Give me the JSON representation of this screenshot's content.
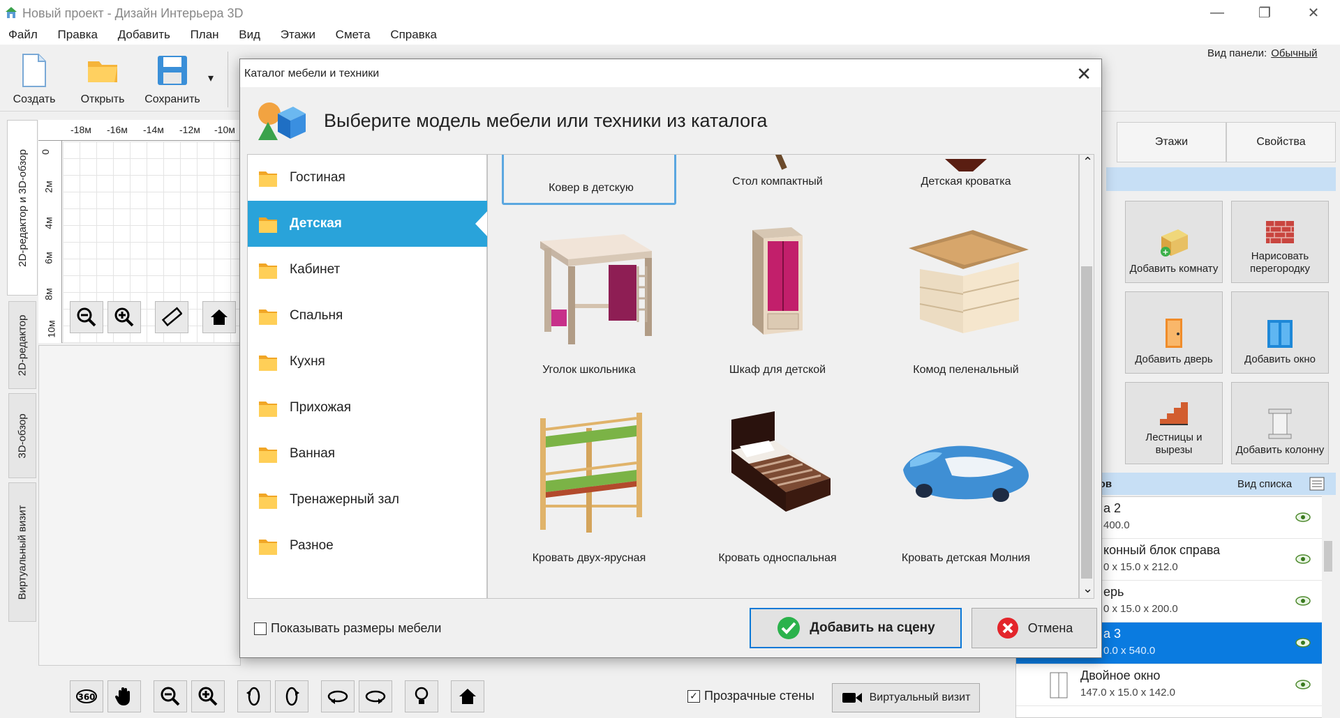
{
  "window": {
    "title": "Новый проект - Дизайн Интерьера 3D",
    "minimize": "—",
    "restore": "❐",
    "close": "✕"
  },
  "menu": [
    "Файл",
    "Правка",
    "Добавить",
    "План",
    "Вид",
    "Этажи",
    "Смета",
    "Справка"
  ],
  "toolbar": {
    "create": "Создать",
    "open": "Открыть",
    "save": "Сохранить",
    "save_dropdown": "▾",
    "panel_view_label": "Вид панели:",
    "panel_view_value": "Обычный"
  },
  "left_tabs": [
    "2D-редактор и 3D-обзор",
    "2D-редактор",
    "3D-обзор",
    "Виртуальный визит"
  ],
  "ruler_top": [
    "-18м",
    "-16м",
    "-14м",
    "-12м",
    "-10м"
  ],
  "ruler_left": [
    "0",
    "2м",
    "4м",
    "6м",
    "8м",
    "10м"
  ],
  "right_panel": {
    "tabs": [
      "Этажи",
      "Свойства"
    ],
    "tiles": [
      {
        "label": "Добавить комнату"
      },
      {
        "label": "Нарисовать перегородку"
      },
      {
        "label": "Добавить дверь"
      },
      {
        "label": "Добавить окно"
      },
      {
        "label": "Лестницы и вырезы"
      },
      {
        "label": "Добавить колонну"
      }
    ],
    "list_header_partial": "ктов",
    "list_view_label": "Вид списка",
    "list": [
      {
        "title": "а 2",
        "dims": "400.0"
      },
      {
        "title": "конный блок справа",
        "dims": "0 x 15.0 x 212.0"
      },
      {
        "title": "ерь",
        "dims": "0 x 15.0 x 200.0"
      },
      {
        "title": "а 3",
        "dims": "0.0 x 540.0",
        "selected": true
      },
      {
        "title": "Двойное окно",
        "dims": "147.0 x 15.0 x 142.0"
      }
    ]
  },
  "bottom": {
    "transparent_walls": "Прозрачные стены",
    "virtual_visit": "Виртуальный визит",
    "transparent_checked": true
  },
  "dialog": {
    "title": "Каталог мебели и техники",
    "heading": "Выберите модель мебели или техники из каталога",
    "categories": [
      "Гостиная",
      "Детская",
      "Кабинет",
      "Спальня",
      "Кухня",
      "Прихожая",
      "Ванная",
      "Тренажерный зал",
      "Разное"
    ],
    "active_category": "Детская",
    "items": [
      "Ковер в детскую",
      "Стол компактный",
      "Детская кроватка",
      "Уголок школьника",
      "Шкаф для детской",
      "Комод пеленальный",
      "Кровать двух-ярусная",
      "Кровать односпальная",
      "Кровать детская Молния"
    ],
    "show_dims": "Показывать размеры мебели",
    "add_button": "Добавить на сцену",
    "cancel_button": "Отмена",
    "scroll_up": "⌃",
    "scroll_down": "⌄"
  }
}
